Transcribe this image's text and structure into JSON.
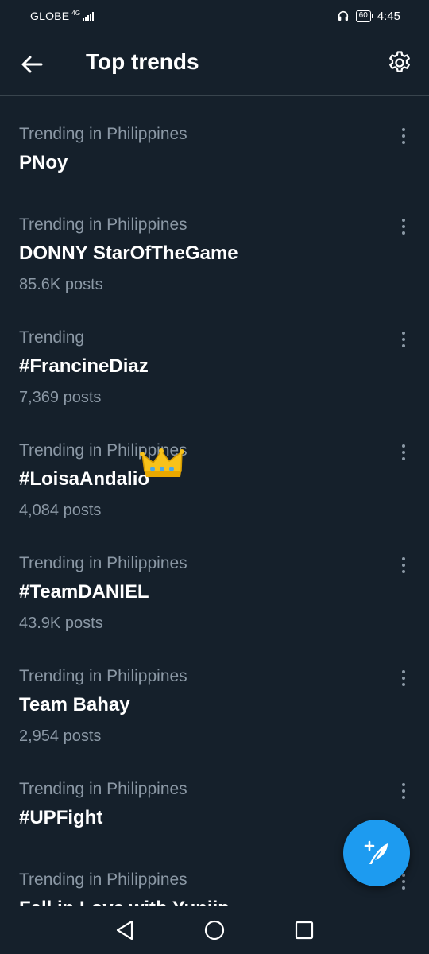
{
  "status_bar": {
    "carrier": "GLOBE",
    "network": "4G",
    "battery": "60",
    "time": "4:45"
  },
  "header": {
    "title": "Top trends"
  },
  "trends": [
    {
      "context": "Trending in Philippines",
      "name": "PNoy",
      "count": ""
    },
    {
      "context": "Trending in Philippines",
      "name": "DONNY StarOfTheGame",
      "count": "85.6K posts"
    },
    {
      "context": "Trending",
      "name": "#FrancineDiaz",
      "count": "7,369 posts"
    },
    {
      "context": "Trending in Philippines",
      "name": "#LoisaAndalio",
      "count": "4,084 posts"
    },
    {
      "context": "Trending in Philippines",
      "name": "#TeamDANIEL",
      "count": "43.9K posts"
    },
    {
      "context": "Trending in Philippines",
      "name": "Team Bahay",
      "count": "2,954 posts"
    },
    {
      "context": "Trending in Philippines",
      "name": "#UPFight",
      "count": ""
    },
    {
      "context": "Trending in Philippines",
      "name": "Fall in Love with Yunjin",
      "count": ""
    }
  ],
  "colors": {
    "background": "#15202b",
    "accent": "#1d9bf0",
    "secondary_text": "#8b98a5",
    "divider": "#38444d"
  },
  "icons": {
    "back": "arrow-left-icon",
    "settings": "gear-icon",
    "more": "more-vertical-icon",
    "fab": "compose-feather-icon",
    "crown": "crown-emoji"
  }
}
